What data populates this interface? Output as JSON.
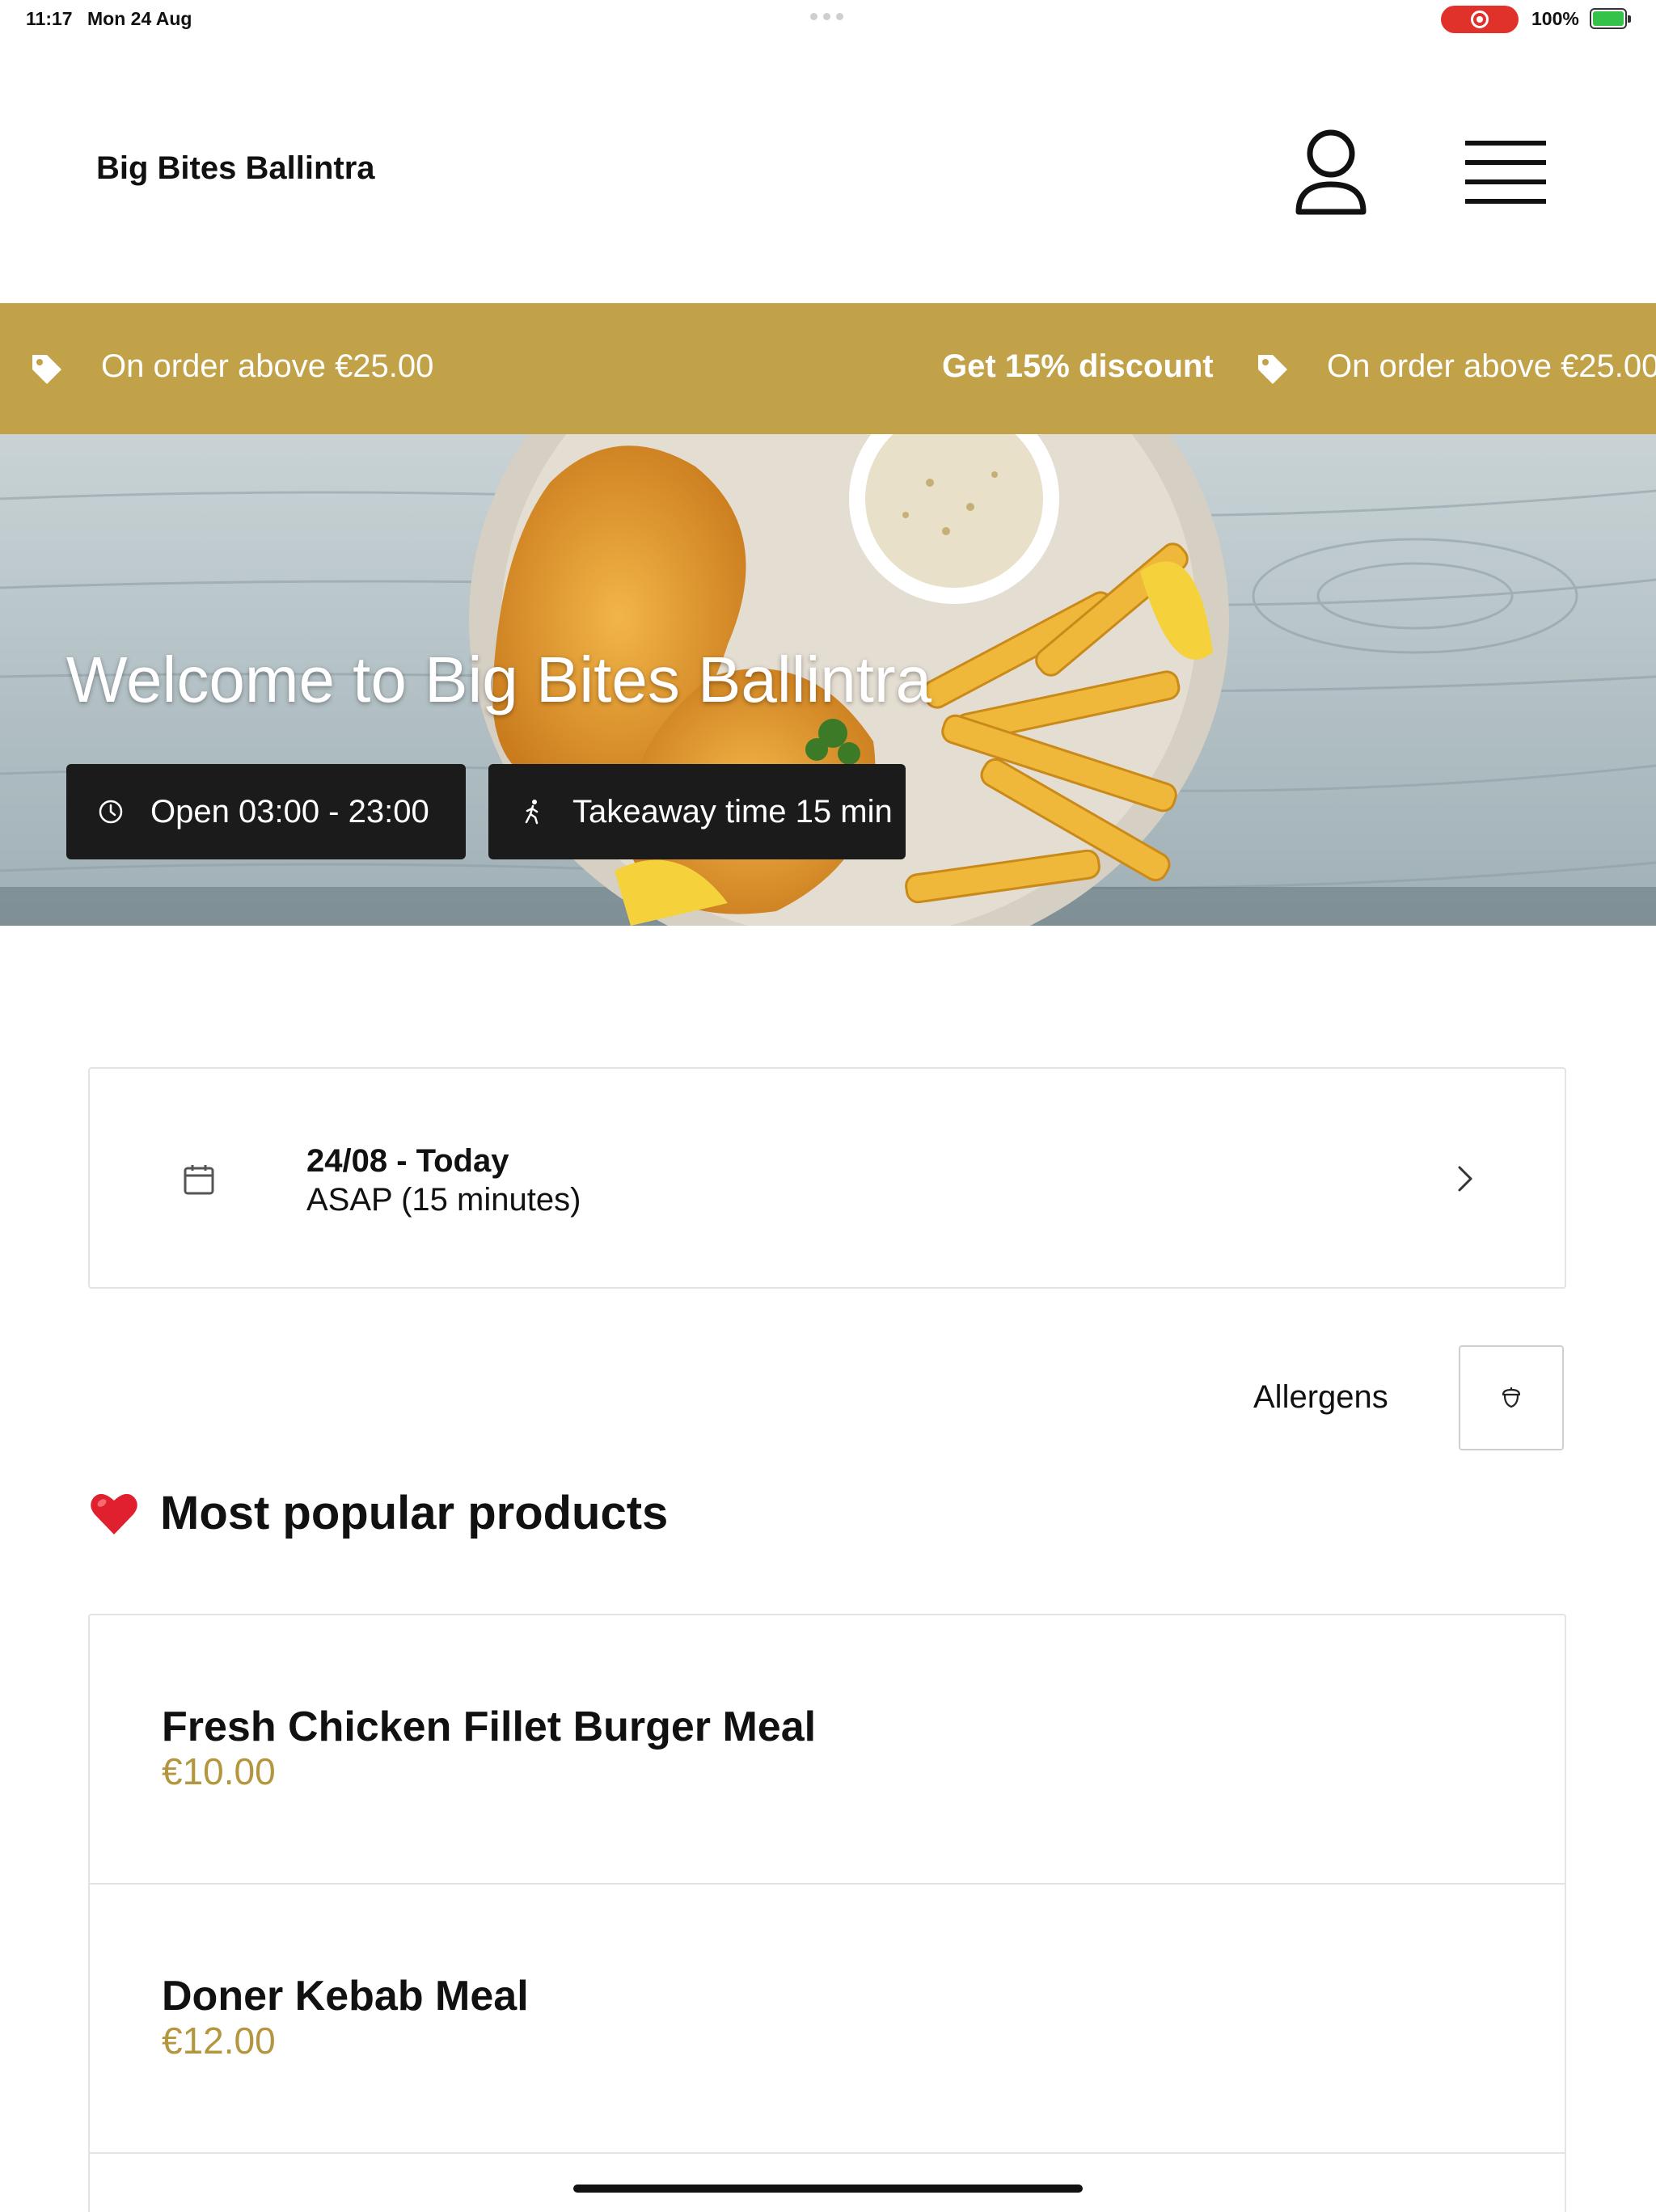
{
  "status_bar": {
    "time": "11:17",
    "date": "Mon 24 Aug",
    "battery": "100%"
  },
  "header": {
    "brand": "Big Bites Ballintra",
    "account_icon": "user-icon",
    "menu_icon": "hamburger-menu-icon"
  },
  "promo": {
    "min_order_text": "On order above €25.00",
    "discount_text": "Get 15% discount",
    "tag_icon": "tag-icon",
    "background_color": "#c1a248"
  },
  "hero": {
    "title": "Welcome to Big Bites Ballintra",
    "opening_hours": "Open 03:00 - 23:00",
    "takeaway_time": "Takeaway time 15 min"
  },
  "order_time": {
    "date_label": "24/08 - Today",
    "time_label": "ASAP (15 minutes)"
  },
  "allergens": {
    "label": "Allergens"
  },
  "popular": {
    "title": "Most popular products",
    "products": [
      {
        "name": "Fresh Chicken Fillet Burger Meal",
        "price": "€10.00"
      },
      {
        "name": "Doner Kebab Meal",
        "price": "€12.00"
      }
    ],
    "price_color": "#b3963e"
  }
}
